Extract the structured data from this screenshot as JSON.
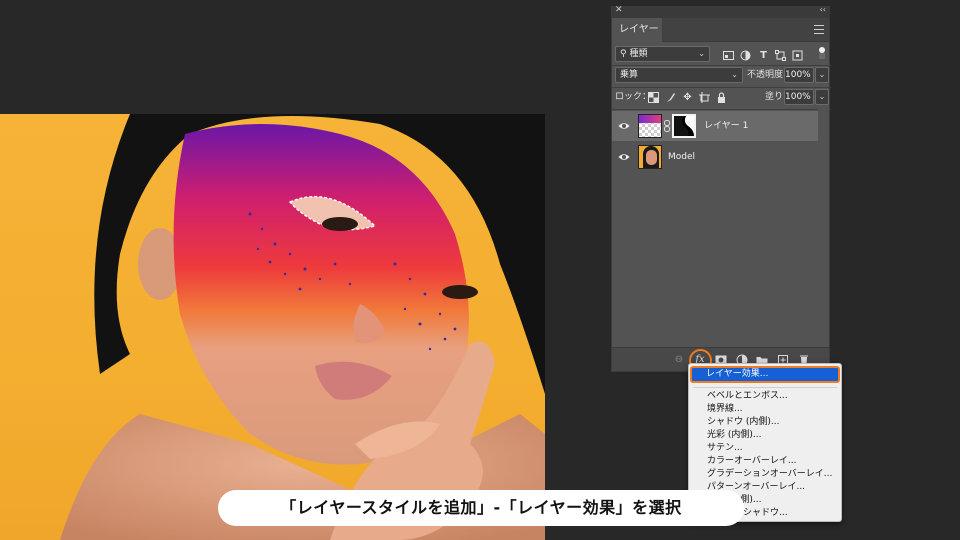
{
  "panel": {
    "tab_label": "レイヤー",
    "filter_label": "種類",
    "blend_mode": "乗算",
    "opacity_label": "不透明度：",
    "opacity_value": "100%",
    "lock_label": "ロック：",
    "fill_label": "塗り：",
    "fill_value": "100%",
    "layers": [
      {
        "name": "レイヤー 1",
        "selected": true
      },
      {
        "name": "Model",
        "selected": false
      }
    ],
    "bottom_icons": [
      "link-icon",
      "fx-icon",
      "mask-icon",
      "adjustment-icon",
      "folder-icon",
      "new-layer-icon",
      "trash-icon"
    ],
    "fx_label": "fx"
  },
  "menu": {
    "items": [
      "レイヤー効果...",
      "ベベルとエンボス...",
      "境界線...",
      "シャドウ (内側)...",
      "光彩 (内側)...",
      "サテン...",
      "カラーオーバーレイ...",
      "グラデーションオーバーレイ...",
      "パターンオーバーレイ...",
      "光彩 (外側)...",
      "ドロップシャドウ..."
    ],
    "items_visible": [
      "レイヤー効果...",
      "ベベルとエンボス...",
      "境界線...",
      "シャドウ (内側)...",
      "光彩 (内側)...",
      "サテン...",
      "カラーオーバーレイ...",
      "グラデーションオーバーレイ...",
      "パターンオーバーレイ...",
      "光彩 (外側)...",
      "ドロップシャドウ..."
    ]
  },
  "caption": "「レイヤースタイルを追加」-「レイヤー効果」を選択",
  "colors": {
    "app_bg": "#282828",
    "panel_bg": "#535353",
    "highlight_blue": "#1560d4",
    "accent_orange": "#f07a1c",
    "backdrop_yellow": "#f6b338"
  }
}
